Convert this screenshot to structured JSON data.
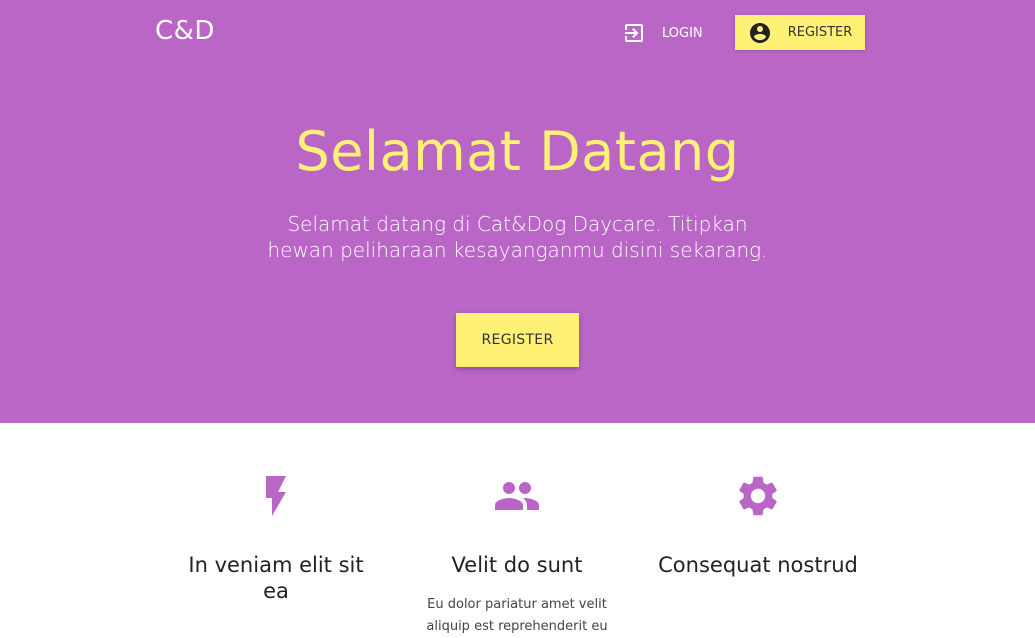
{
  "nav": {
    "logo": "C&D",
    "login_label": "LOGIN",
    "register_label": "REGISTER"
  },
  "hero": {
    "title": "Selamat Datang",
    "subtitle": "Selamat datang di Cat&Dog Daycare. Titipkan hewan peliharaan kesayanganmu disini sekarang.",
    "button_label": "REGISTER"
  },
  "features": [
    {
      "icon": "flash-icon",
      "title": "In veniam elit sit ea",
      "text": ""
    },
    {
      "icon": "people-icon",
      "title": "Velit do sunt",
      "text": "Eu dolor pariatur amet velit aliquip est reprehenderit eu"
    },
    {
      "icon": "gear-icon",
      "title": "Consequat nostrud",
      "text": ""
    }
  ],
  "colors": {
    "hero_bg": "#b966c6",
    "accent_yellow": "#fff176",
    "icon_purple": "#b966c6"
  }
}
